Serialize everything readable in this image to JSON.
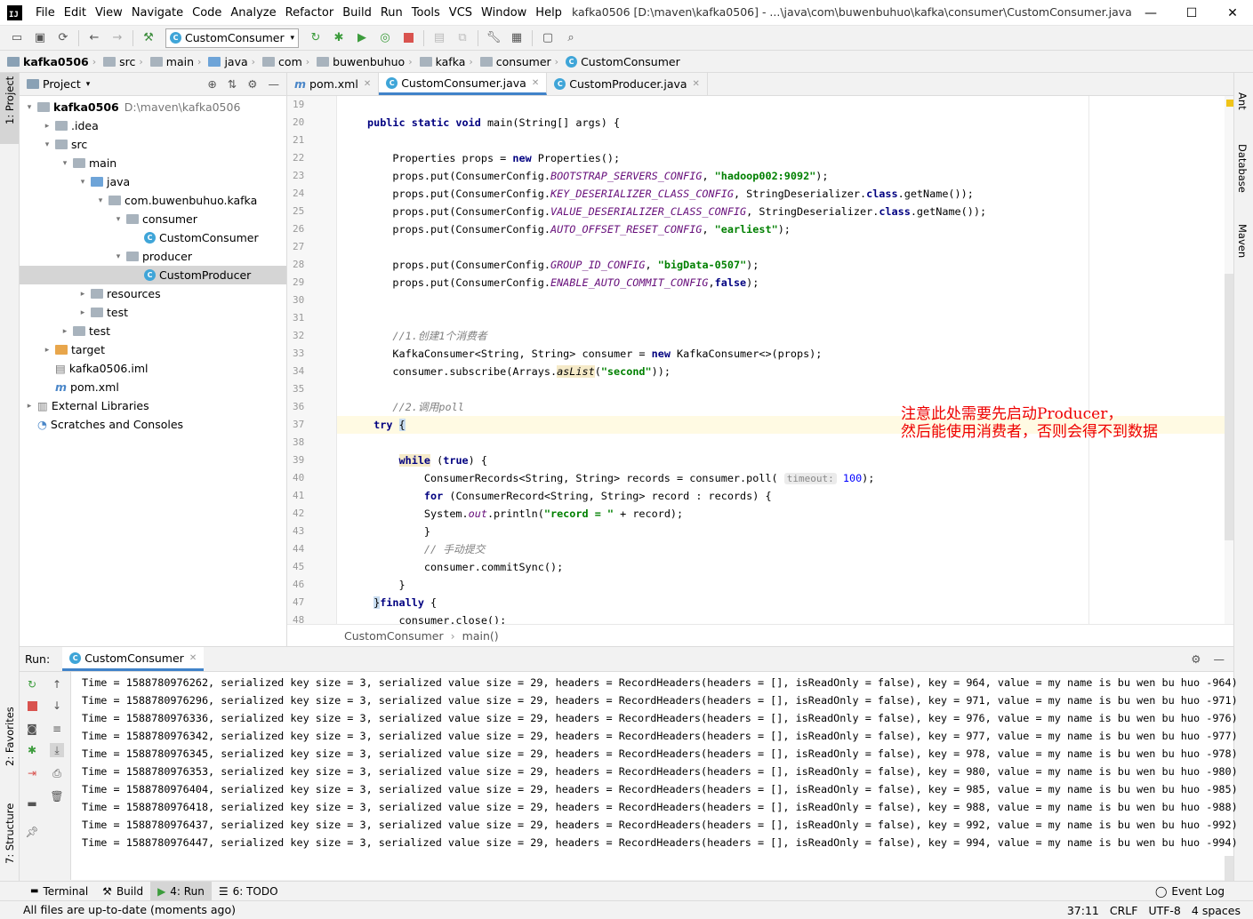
{
  "titlebar": {
    "logo": "IJ",
    "menu": [
      "File",
      "Edit",
      "View",
      "Navigate",
      "Code",
      "Analyze",
      "Refactor",
      "Build",
      "Run",
      "Tools",
      "VCS",
      "Window",
      "Help"
    ],
    "title": "kafka0506 [D:\\maven\\kafka0506] - ...\\java\\com\\buwenbuhuo\\kafka\\consumer\\CustomConsumer.java",
    "controls": [
      "—",
      "☐",
      "✕"
    ]
  },
  "toolbar": {
    "run_config": "CustomConsumer"
  },
  "breadcrumbs": [
    "kafka0506",
    "src",
    "main",
    "java",
    "com",
    "buwenbuhuo",
    "kafka",
    "consumer",
    "CustomConsumer"
  ],
  "left_stripe": {
    "project_tab": "1: Project",
    "favorites_tab": "2: Favorites",
    "structure_tab": "7: Structure"
  },
  "project": {
    "header": "Project",
    "tree": [
      {
        "label": "kafka0506",
        "extra": "D:\\maven\\kafka0506",
        "depth": 0,
        "arrow": "▾",
        "icon": "folder",
        "bold": true
      },
      {
        "label": ".idea",
        "depth": 1,
        "arrow": "▸",
        "icon": "folder"
      },
      {
        "label": "src",
        "depth": 1,
        "arrow": "▾",
        "icon": "folder"
      },
      {
        "label": "main",
        "depth": 2,
        "arrow": "▾",
        "icon": "folder"
      },
      {
        "label": "java",
        "depth": 3,
        "arrow": "▾",
        "icon": "folder-blue"
      },
      {
        "label": "com.buwenbuhuo.kafka",
        "depth": 4,
        "arrow": "▾",
        "icon": "folder"
      },
      {
        "label": "consumer",
        "depth": 5,
        "arrow": "▾",
        "icon": "folder"
      },
      {
        "label": "CustomConsumer",
        "depth": 6,
        "arrow": "",
        "icon": "class"
      },
      {
        "label": "producer",
        "depth": 5,
        "arrow": "▾",
        "icon": "folder"
      },
      {
        "label": "CustomProducer",
        "depth": 6,
        "arrow": "",
        "icon": "class",
        "selected": true
      },
      {
        "label": "resources",
        "depth": 3,
        "arrow": "▸",
        "icon": "folder"
      },
      {
        "label": "test",
        "depth": 3,
        "arrow": "▸",
        "icon": "folder"
      },
      {
        "label": "test",
        "depth": 2,
        "arrow": "▸",
        "icon": "folder"
      },
      {
        "label": "target",
        "depth": 1,
        "arrow": "▸",
        "icon": "folder-orange"
      },
      {
        "label": "kafka0506.iml",
        "depth": 1,
        "arrow": "",
        "icon": "file"
      },
      {
        "label": "pom.xml",
        "depth": 1,
        "arrow": "",
        "icon": "maven"
      },
      {
        "label": "External Libraries",
        "depth": 0,
        "arrow": "▸",
        "icon": "lib"
      },
      {
        "label": "Scratches and Consoles",
        "depth": 0,
        "arrow": "",
        "icon": "scratch"
      }
    ]
  },
  "editor": {
    "tabs": [
      {
        "label": "pom.xml",
        "icon": "m",
        "active": false
      },
      {
        "label": "CustomConsumer.java",
        "icon": "c",
        "active": true
      },
      {
        "label": "CustomProducer.java",
        "icon": "c",
        "active": false
      }
    ],
    "line_numbers": [
      "19",
      "20",
      "21",
      "22",
      "23",
      "24",
      "25",
      "26",
      "27",
      "28",
      "29",
      "30",
      "31",
      "32",
      "33",
      "34",
      "35",
      "36",
      "37",
      "38",
      "39",
      "40",
      "41",
      "42",
      "43",
      "44",
      "45",
      "46",
      "47",
      "48"
    ],
    "annotation": "注意此处需要先启动Producer，\n然后能使用消费者，否则会得不到数据",
    "breadcrumb": [
      "CustomConsumer",
      "main()"
    ]
  },
  "right_stripe": {
    "ant": "Ant",
    "database": "Database",
    "maven": "Maven"
  },
  "run": {
    "label": "Run:",
    "tab": "CustomConsumer",
    "lines": [
      {
        "time": "1588780976262",
        "key": "964"
      },
      {
        "time": "1588780976296",
        "key": "971"
      },
      {
        "time": "1588780976336",
        "key": "976"
      },
      {
        "time": "1588780976342",
        "key": "977"
      },
      {
        "time": "1588780976345",
        "key": "978"
      },
      {
        "time": "1588780976353",
        "key": "980"
      },
      {
        "time": "1588780976404",
        "key": "985"
      },
      {
        "time": "1588780976418",
        "key": "988"
      },
      {
        "time": "1588780976437",
        "key": "992"
      },
      {
        "time": "1588780976447",
        "key": "994"
      }
    ],
    "line_template": "Time = {time}, serialized key size = 3, serialized value size = 29, headers = RecordHeaders(headers = [], isReadOnly = false), key = {key}, value = my name is bu wen bu huo -{key})"
  },
  "bottom_tabs": [
    "Terminal",
    "Build",
    "4: Run",
    "6: TODO"
  ],
  "event_log": "Event Log",
  "status": {
    "message": "All files are up-to-date (moments ago)",
    "position": "37:11",
    "line_sep": "CRLF",
    "encoding": "UTF-8",
    "indent": "4 spaces"
  }
}
